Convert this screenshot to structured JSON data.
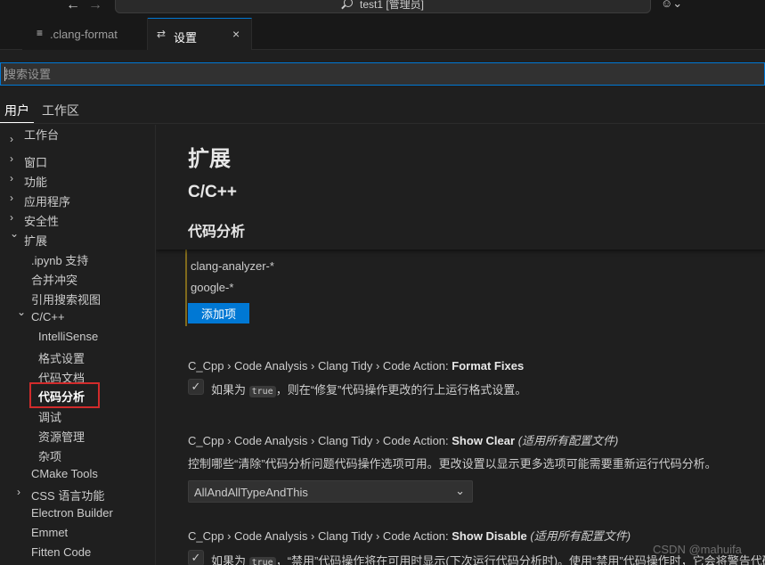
{
  "titlebar": {
    "back_icon": "arrow-left-icon",
    "forward_icon": "arrow-right-icon",
    "title": "test1 [管理员]",
    "copilot_icon": "copilot-icon"
  },
  "tabs": [
    {
      "label": ".clang-format",
      "icon": "file-lines-icon",
      "active": false
    },
    {
      "label": "设置",
      "icon": "settings-sliders-icon",
      "active": true,
      "close": "×"
    }
  ],
  "search": {
    "placeholder": "搜索设置",
    "value": ""
  },
  "scope_tabs": [
    {
      "label": "用户",
      "active": true
    },
    {
      "label": "工作区",
      "active": false
    }
  ],
  "toc": [
    {
      "label": "工作台",
      "chevron": "›",
      "level": 0
    },
    {
      "label": "窗口",
      "chevron": "›",
      "level": 0
    },
    {
      "label": "功能",
      "chevron": "›",
      "level": 0
    },
    {
      "label": "应用程序",
      "chevron": "›",
      "level": 0
    },
    {
      "label": "安全性",
      "chevron": "›",
      "level": 0
    },
    {
      "label": "扩展",
      "chevron": "⌄",
      "level": 0
    },
    {
      "label": ".ipynb 支持",
      "level": 1
    },
    {
      "label": "合并冲突",
      "level": 1
    },
    {
      "label": "引用搜索视图",
      "level": 1
    },
    {
      "label": "C/C++",
      "chevron": "⌄",
      "level": 1
    },
    {
      "label": "IntelliSense",
      "level": 2
    },
    {
      "label": "格式设置",
      "level": 2
    },
    {
      "label": "代码文档",
      "level": 2
    },
    {
      "label": "代码分析",
      "level": 2,
      "selected": true
    },
    {
      "label": "调试",
      "level": 2
    },
    {
      "label": "资源管理",
      "level": 2
    },
    {
      "label": "杂项",
      "level": 2
    },
    {
      "label": "CMake Tools",
      "level": 1
    },
    {
      "label": "CSS 语言功能",
      "chevron": "›",
      "level": 1
    },
    {
      "label": "Electron Builder",
      "level": 1
    },
    {
      "label": "Emmet",
      "level": 1
    },
    {
      "label": "Fitten Code",
      "level": 1
    }
  ],
  "main": {
    "h1": "扩展",
    "h2": "C/C++",
    "h3": "代码分析",
    "list_items": [
      "clang-analyzer-*",
      "google-*"
    ],
    "add_button": "添加项",
    "settings": [
      {
        "breadcrumb": "C_Cpp › Code Analysis › Clang Tidy › Code Action: ",
        "key": "Format Fixes",
        "checked": "✓",
        "desc_before": "如果为 ",
        "code": "true",
        "desc_after": "，则在“修复”代码操作更改的行上运行格式设置。"
      },
      {
        "breadcrumb": "C_Cpp › Code Analysis › Clang Tidy › Code Action: ",
        "key": "Show Clear",
        "scope": "(适用所有配置文件)",
        "description": "控制哪些“清除”代码分析问题代码操作选项可用。更改设置以显示更多选项可能需要重新运行代码分析。",
        "dropdown_value": "AllAndAllTypeAndThis",
        "dropdown_icon": "chevron-down-icon"
      },
      {
        "breadcrumb": "C_Cpp › Code Analysis › Clang Tidy › Code Action: ",
        "key": "Show Disable",
        "scope": "(适用所有配置文件)",
        "checked": "✓",
        "desc_before": "如果为 ",
        "code": "true",
        "desc_after": "，“禁用”代码操作将在可用时显示(下次运行代码分析时)。使用“禁用”代码操作时，它会将警告代码"
      }
    ]
  },
  "watermark": "CSDN @mahuifa"
}
